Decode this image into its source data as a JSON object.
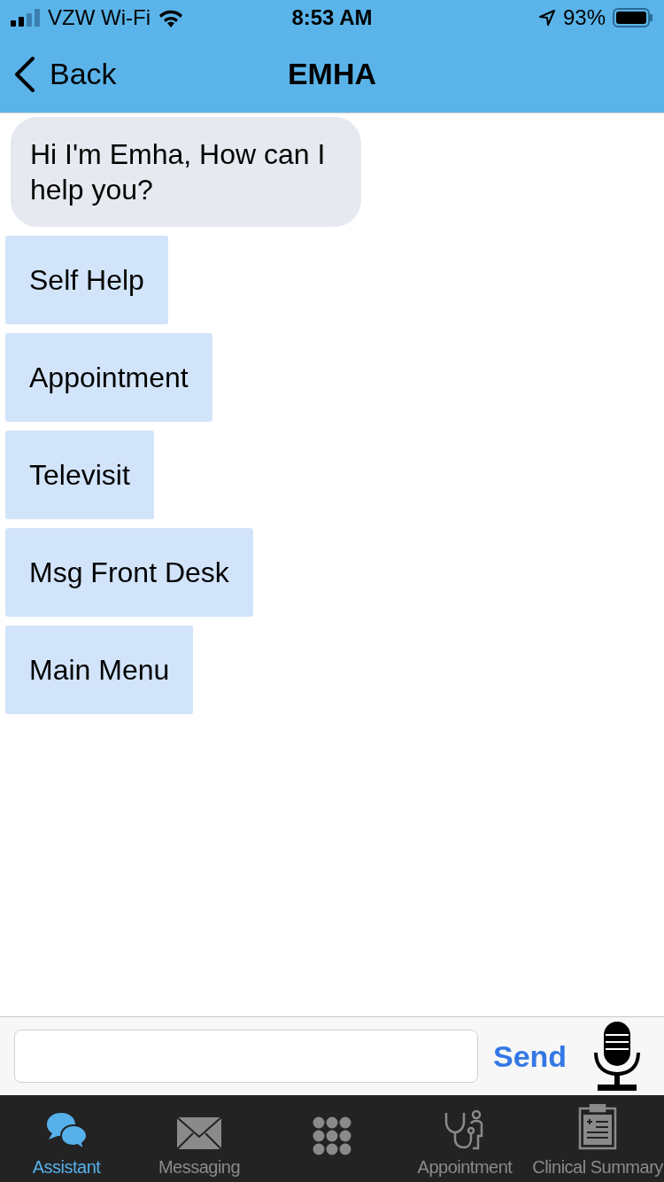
{
  "status_bar": {
    "carrier": "VZW Wi-Fi",
    "time": "8:53 AM",
    "battery": "93%"
  },
  "nav": {
    "back": "Back",
    "title": "EMHA"
  },
  "messages": [
    {
      "text": "Hi I'm Emha, How can I help you?"
    }
  ],
  "quick_replies": [
    {
      "label": "Self Help"
    },
    {
      "label": "Appointment"
    },
    {
      "label": "Televisit"
    },
    {
      "label": "Msg Front Desk"
    },
    {
      "label": "Main Menu"
    }
  ],
  "composer": {
    "send": "Send"
  },
  "tabs": [
    {
      "kind": "chat",
      "label": "Assistant",
      "selected": true
    },
    {
      "kind": "mail",
      "label": "Messaging",
      "selected": false
    },
    {
      "kind": "grid",
      "selected": false
    },
    {
      "kind": "doctor",
      "label": "Appointment",
      "selected": false
    },
    {
      "kind": "clipboard",
      "label": "Clinical Summary",
      "selected": false
    }
  ]
}
